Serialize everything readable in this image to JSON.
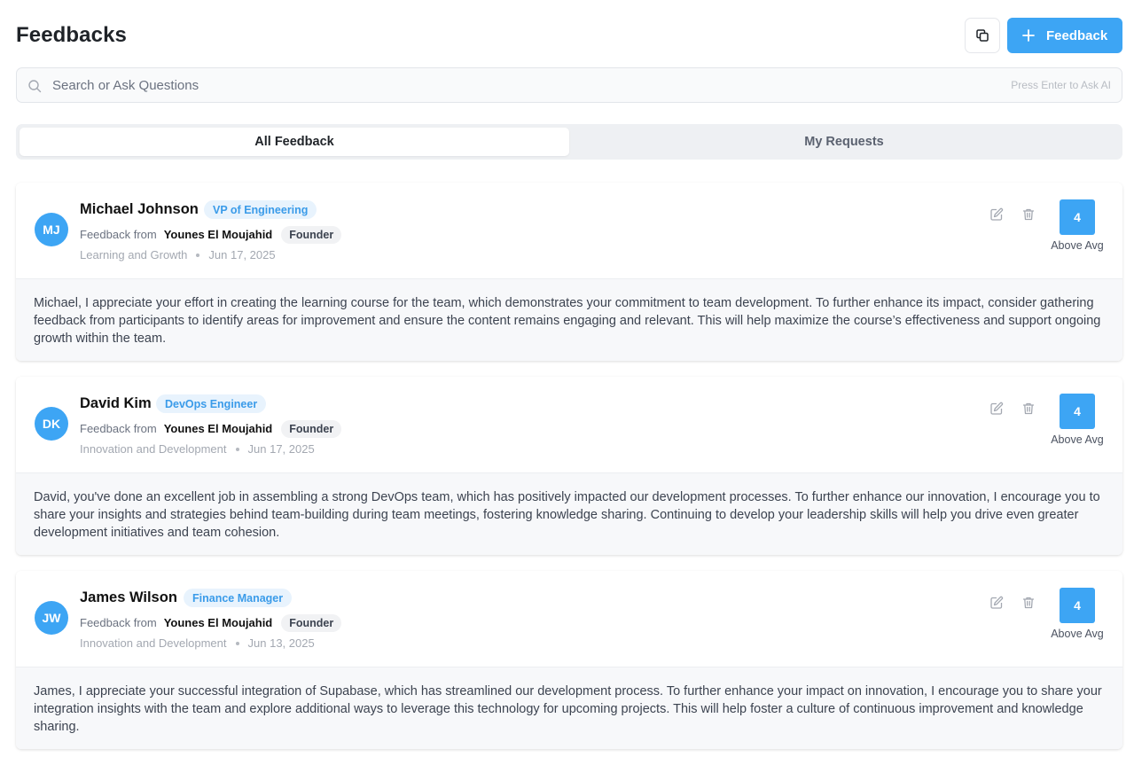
{
  "page": {
    "title": "Feedbacks"
  },
  "toolbar": {
    "add_label": "Feedback",
    "copy_icon": "copy-icon",
    "plus_icon": "plus-icon"
  },
  "search": {
    "placeholder": "Search or Ask Questions",
    "hint": "Press Enter to Ask AI",
    "icon": "search-icon"
  },
  "tabs": [
    {
      "label": "All Feedback",
      "active": true
    },
    {
      "label": "My Requests",
      "active": false
    }
  ],
  "colors": {
    "accent": "#3da5f4",
    "role_badge_bg": "#e8f3fd",
    "role_badge_text": "#3a9be9"
  },
  "feedbacks": [
    {
      "initials": "MJ",
      "name": "Michael Johnson",
      "role": "VP of Engineering",
      "from_label": "Feedback from",
      "giver": "Younes El Moujahid",
      "giver_role": "Founder",
      "category": "Learning and Growth",
      "date": "Jun 17, 2025",
      "score": "4",
      "score_label": "Above Avg",
      "text": "Michael, I appreciate your effort in creating the learning course for the team, which demonstrates your commitment to team development. To further enhance its impact, consider gathering feedback from participants to identify areas for improvement and ensure the content remains engaging and relevant. This will help maximize the course’s effectiveness and support ongoing growth within the team."
    },
    {
      "initials": "DK",
      "name": "David Kim",
      "role": "DevOps Engineer",
      "from_label": "Feedback from",
      "giver": "Younes El Moujahid",
      "giver_role": "Founder",
      "category": "Innovation and Development",
      "date": "Jun 17, 2025",
      "score": "4",
      "score_label": "Above Avg",
      "text": "David, you've done an excellent job in assembling a strong DevOps team, which has positively impacted our development processes. To further enhance our innovation, I encourage you to share your insights and strategies behind team-building during team meetings, fostering knowledge sharing. Continuing to develop your leadership skills will help you drive even greater development initiatives and team cohesion."
    },
    {
      "initials": "JW",
      "name": "James Wilson",
      "role": "Finance Manager",
      "from_label": "Feedback from",
      "giver": "Younes El Moujahid",
      "giver_role": "Founder",
      "category": "Innovation and Development",
      "date": "Jun 13, 2025",
      "score": "4",
      "score_label": "Above Avg",
      "text": "James, I appreciate your successful integration of Supabase, which has streamlined our development process. To further enhance your impact on innovation, I encourage you to share your integration insights with the team and explore additional ways to leverage this technology for upcoming projects. This will help foster a culture of continuous improvement and knowledge sharing."
    }
  ]
}
